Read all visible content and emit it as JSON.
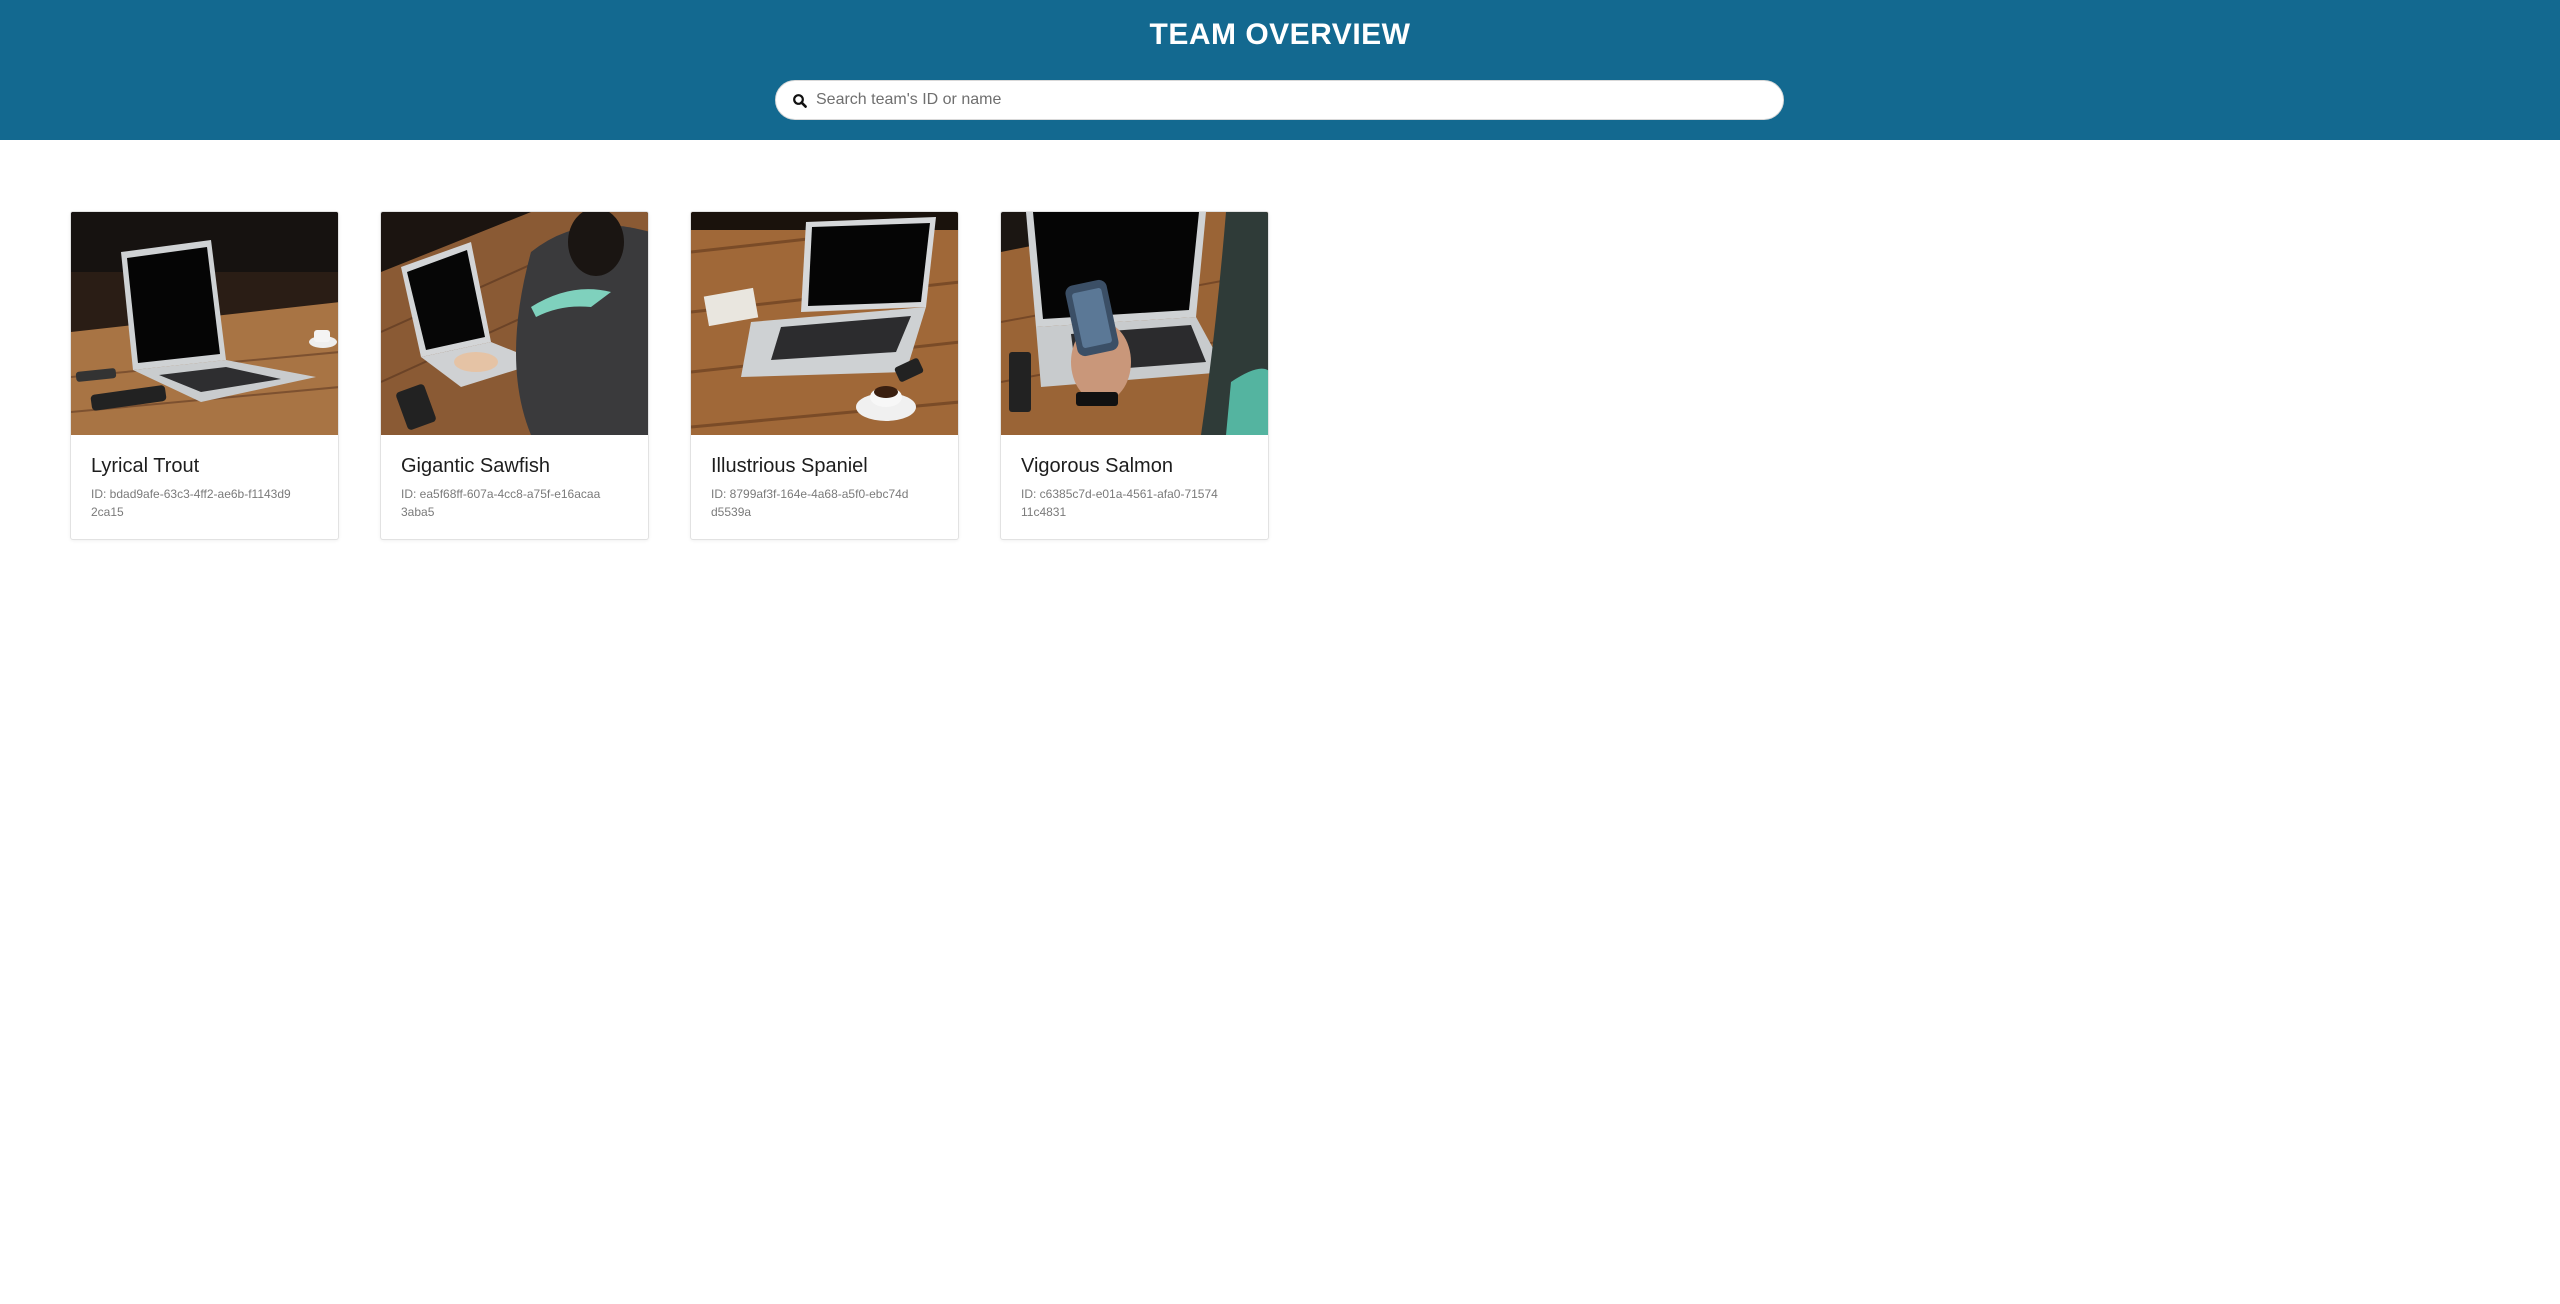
{
  "header": {
    "title": "TEAM OVERVIEW",
    "search_placeholder": "Search team's ID or name",
    "background_color": "#136990"
  },
  "teams": [
    {
      "name": "Lyrical Trout",
      "id": "ID: bdad9afe-63c3-4ff2-ae6b-f1143d92ca15",
      "image_icon": "laptop-photo"
    },
    {
      "name": "Gigantic Sawfish",
      "id": "ID: ea5f68ff-607a-4cc8-a75f-e16acaa3aba5",
      "image_icon": "person-typing-photo"
    },
    {
      "name": "Illustrious Spaniel",
      "id": "ID: 8799af3f-164e-4a68-a5f0-ebc74dd5539a",
      "image_icon": "laptop-coffee-photo"
    },
    {
      "name": "Vigorous Salmon",
      "id": "ID: c6385c7d-e01a-4561-afa0-7157411c4831",
      "image_icon": "phone-laptop-photo"
    }
  ]
}
